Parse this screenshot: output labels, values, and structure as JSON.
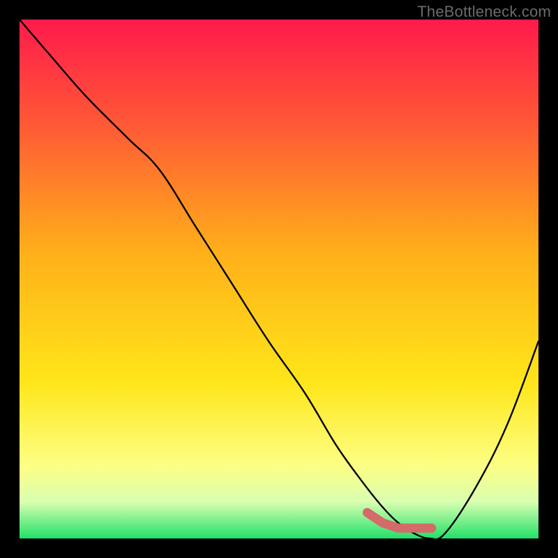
{
  "watermark": "TheBottleneck.com",
  "chart_data": {
    "type": "line",
    "title": "",
    "xlabel": "",
    "ylabel": "",
    "xlim": [
      0,
      100
    ],
    "ylim": [
      0,
      100
    ],
    "grid": false,
    "legend": false,
    "gradient_stops": [
      {
        "pos": 0.0,
        "color": "#ff1a4b"
      },
      {
        "pos": 0.2,
        "color": "#ff5836"
      },
      {
        "pos": 0.45,
        "color": "#ffb01a"
      },
      {
        "pos": 0.7,
        "color": "#ffe61a"
      },
      {
        "pos": 0.86,
        "color": "#fdff84"
      },
      {
        "pos": 0.93,
        "color": "#d8ffb0"
      },
      {
        "pos": 1.0,
        "color": "#22e06a"
      }
    ],
    "series": [
      {
        "name": "bottleneck-curve",
        "x": [
          0,
          6,
          13,
          21,
          27,
          34,
          41,
          48,
          55,
          61,
          66,
          70,
          73,
          76,
          79,
          82,
          88,
          94,
          100
        ],
        "y": [
          100,
          93,
          85,
          77,
          71,
          60,
          49,
          38,
          28,
          18,
          11,
          6,
          3,
          1,
          0,
          1,
          10,
          22,
          38
        ]
      },
      {
        "name": "marker-segment",
        "x": [
          67,
          70,
          73,
          76,
          79,
          80,
          81
        ],
        "y": [
          5,
          3,
          2,
          2,
          2,
          2,
          2
        ]
      }
    ],
    "marker_style": {
      "color": "#d46a6a",
      "stroke_width_px": 13,
      "dashed_tail": true
    }
  }
}
